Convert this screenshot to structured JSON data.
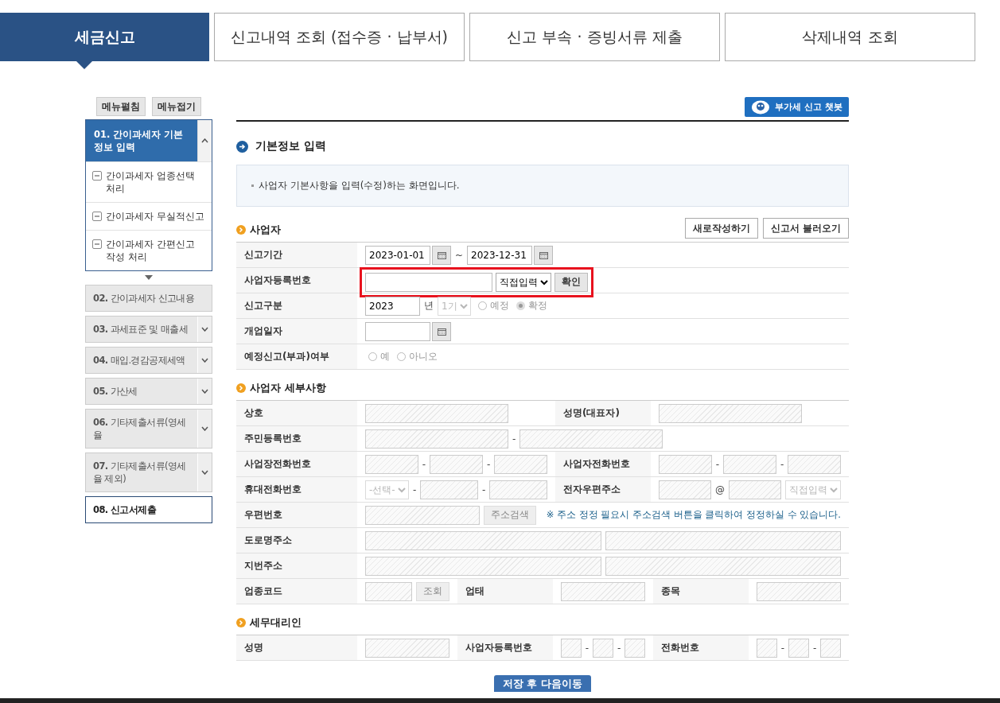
{
  "tabs": [
    {
      "label": "세금신고",
      "selected": true
    },
    {
      "label": "신고내역 조회 (접수증 · 납부서)",
      "selected": false
    },
    {
      "label": "신고 부속 · 증빙서류 제출",
      "selected": false
    },
    {
      "label": "삭제내역 조회",
      "selected": false
    }
  ],
  "sidebar": {
    "buttons": [
      "메뉴펼침",
      "메뉴접기"
    ],
    "steps": [
      {
        "number": "01.",
        "label": "간이과세자 기본정보 입력",
        "selected": true,
        "disabled": false,
        "expanded": true,
        "children": [
          "간이과세자 업종선택 처리",
          "간이과세자 무실적신고",
          "간이과세자 간편신고 작성 처리"
        ]
      },
      {
        "number": "02.",
        "label": "간이과세자 신고내용",
        "selected": false,
        "disabled": true
      },
      {
        "number": "03.",
        "label": "과세표준 및 매출세",
        "selected": false,
        "disabled": true,
        "expanded": false
      },
      {
        "number": "04.",
        "label": "매입.경감공제세액",
        "selected": false,
        "disabled": true,
        "expanded": false
      },
      {
        "number": "05.",
        "label": "가산세",
        "selected": false,
        "disabled": true,
        "expanded": false
      },
      {
        "number": "06.",
        "label": "기타제출서류(영세율",
        "selected": false,
        "disabled": true,
        "expanded": false
      },
      {
        "number": "07.",
        "label": "기타제출서류(영세율 제외)",
        "selected": false,
        "disabled": true,
        "expanded": false
      },
      {
        "number": "08.",
        "label": "신고서제출",
        "selected": false,
        "disabled": false
      }
    ]
  },
  "main": {
    "chatbot_button": "부가세 신고 챗봇",
    "title": "기본정보 입력",
    "notice": "사업자 기본사항을 입력(수정)하는 화면입니다.",
    "sections": [
      {
        "title": "사업자",
        "buttons": [
          "새로작성하기",
          "신고서 불러오기"
        ],
        "rows": [
          {
            "kind": "standard",
            "cells": [
              {
                "kind": "label",
                "text": "신고기간"
              },
              {
                "kind": "value",
                "controls": [
                  {
                    "kind": "date",
                    "value": "2023-01-01"
                  },
                  {
                    "kind": "text",
                    "text": "~"
                  },
                  {
                    "kind": "date",
                    "value": "2023-12-31"
                  }
                ]
              }
            ]
          },
          {
            "kind": "standard",
            "cells": [
              {
                "kind": "label",
                "text": "사업자등록번호"
              },
              {
                "kind": "value",
                "highlighted": true,
                "controls": [
                  {
                    "kind": "input",
                    "disabled": false
                  },
                  {
                    "kind": "select",
                    "value": "직접입력",
                    "disabled": false
                  },
                  {
                    "kind": "button",
                    "label": "확인",
                    "disabled": false
                  }
                ]
              }
            ]
          },
          {
            "kind": "standard",
            "cells": [
              {
                "kind": "label",
                "text": "신고구분"
              },
              {
                "kind": "value",
                "controls": [
                  {
                    "kind": "input",
                    "value": "2023",
                    "disabled": false
                  },
                  {
                    "kind": "text",
                    "text": "년"
                  },
                  {
                    "kind": "select",
                    "value": "1기",
                    "disabled": true
                  },
                  {
                    "kind": "radio",
                    "label": "예정",
                    "checked": false,
                    "disabled": true
                  },
                  {
                    "kind": "radio",
                    "label": "확정",
                    "checked": true,
                    "disabled": true
                  }
                ]
              }
            ]
          },
          {
            "kind": "standard",
            "cells": [
              {
                "kind": "label",
                "text": "개업일자"
              },
              {
                "kind": "value",
                "controls": [
                  {
                    "kind": "date"
                  }
                ]
              }
            ]
          },
          {
            "kind": "standard",
            "cells": [
              {
                "kind": "label",
                "text": "예정신고(부과)여부"
              },
              {
                "kind": "value",
                "controls": [
                  {
                    "kind": "radio",
                    "label": "예",
                    "checked": false,
                    "disabled": true
                  },
                  {
                    "kind": "radio",
                    "label": "아니오",
                    "checked": false,
                    "disabled": true
                  }
                ]
              }
            ]
          }
        ]
      },
      {
        "title": "사업자 세부사항",
        "rows": [
          {
            "kind": "standard",
            "cells": [
              {
                "kind": "label",
                "text": "상호"
              },
              {
                "kind": "value",
                "controls": [
                  {
                    "kind": "input",
                    "disabled": true
                  }
                ]
              },
              {
                "kind": "label",
                "text": "성명(대표자)"
              },
              {
                "kind": "value",
                "controls": [
                  {
                    "kind": "input",
                    "disabled": true
                  }
                ]
              }
            ]
          },
          {
            "kind": "standard",
            "cells": [
              {
                "kind": "label",
                "text": "주민등록번호"
              },
              {
                "kind": "value",
                "controls": [
                  {
                    "kind": "input",
                    "disabled": true
                  },
                  {
                    "kind": "text",
                    "text": "-"
                  },
                  {
                    "kind": "input",
                    "disabled": true
                  }
                ]
              }
            ]
          },
          {
            "kind": "standard",
            "cells": [
              {
                "kind": "label",
                "text": "사업장전화번호"
              },
              {
                "kind": "value",
                "controls": [
                  {
                    "kind": "input",
                    "disabled": true
                  },
                  {
                    "kind": "text",
                    "text": "-"
                  },
                  {
                    "kind": "input",
                    "disabled": true
                  },
                  {
                    "kind": "text",
                    "text": "-"
                  },
                  {
                    "kind": "input",
                    "disabled": true
                  }
                ]
              },
              {
                "kind": "label",
                "text": "사업자전화번호"
              },
              {
                "kind": "value",
                "controls": [
                  {
                    "kind": "input",
                    "disabled": true
                  },
                  {
                    "kind": "text",
                    "text": "-"
                  },
                  {
                    "kind": "input",
                    "disabled": true
                  },
                  {
                    "kind": "text",
                    "text": "-"
                  },
                  {
                    "kind": "input",
                    "disabled": true
                  }
                ]
              }
            ]
          },
          {
            "kind": "standard",
            "cells": [
              {
                "kind": "label",
                "text": "휴대전화번호"
              },
              {
                "kind": "value",
                "controls": [
                  {
                    "kind": "select",
                    "value": "-선택-",
                    "disabled": true
                  },
                  {
                    "kind": "text",
                    "text": "-"
                  },
                  {
                    "kind": "input",
                    "disabled": true
                  },
                  {
                    "kind": "text",
                    "text": "-"
                  },
                  {
                    "kind": "input",
                    "disabled": true
                  }
                ]
              },
              {
                "kind": "label",
                "text": "전자우편주소"
              },
              {
                "kind": "value",
                "controls": [
                  {
                    "kind": "input",
                    "disabled": true
                  },
                  {
                    "kind": "text",
                    "text": "@"
                  },
                  {
                    "kind": "input",
                    "disabled": true
                  },
                  {
                    "kind": "select",
                    "value": "직접입력",
                    "disabled": true
                  }
                ]
              }
            ]
          },
          {
            "kind": "standard",
            "cells": [
              {
                "kind": "label",
                "text": "우편번호"
              },
              {
                "kind": "value",
                "controls": [
                  {
                    "kind": "input",
                    "disabled": true
                  },
                  {
                    "kind": "button",
                    "label": "주소검색",
                    "disabled": true
                  },
                  {
                    "kind": "note",
                    "text": "※ 주소 정정 필요시 주소검색 버튼을 클릭하여 정정하실 수 있습니다."
                  }
                ]
              }
            ]
          },
          {
            "kind": "address",
            "cells": [
              {
                "kind": "label",
                "text": "도로명주소"
              },
              {
                "kind": "value",
                "controls": [
                  {
                    "kind": "input",
                    "disabled": true
                  },
                  {
                    "kind": "input",
                    "disabled": true
                  }
                ]
              }
            ]
          },
          {
            "kind": "address",
            "cells": [
              {
                "kind": "label",
                "text": "지번주소"
              },
              {
                "kind": "value",
                "controls": [
                  {
                    "kind": "input",
                    "disabled": true
                  },
                  {
                    "kind": "input",
                    "disabled": true
                  }
                ]
              }
            ]
          },
          {
            "kind": "standard",
            "cells": [
              {
                "kind": "label",
                "text": "업종코드"
              },
              {
                "kind": "value",
                "controls": [
                  {
                    "kind": "input",
                    "disabled": true
                  },
                  {
                    "kind": "button",
                    "label": "조회",
                    "disabled": true
                  }
                ]
              },
              {
                "kind": "label",
                "text": "업태"
              },
              {
                "kind": "value",
                "controls": [
                  {
                    "kind": "input",
                    "disabled": true
                  }
                ]
              },
              {
                "kind": "label",
                "text": "종목"
              },
              {
                "kind": "value",
                "controls": [
                  {
                    "kind": "input",
                    "disabled": true
                  }
                ]
              }
            ]
          }
        ]
      },
      {
        "title": "세무대리인",
        "rows": [
          {
            "kind": "standard",
            "cells": [
              {
                "kind": "label",
                "text": "성명"
              },
              {
                "kind": "value",
                "controls": [
                  {
                    "kind": "input",
                    "disabled": true
                  }
                ]
              },
              {
                "kind": "label",
                "text": "사업자등록번호"
              },
              {
                "kind": "value",
                "controls": [
                  {
                    "kind": "input",
                    "disabled": true
                  },
                  {
                    "kind": "text",
                    "text": "-"
                  },
                  {
                    "kind": "input",
                    "disabled": true
                  },
                  {
                    "kind": "text",
                    "text": "-"
                  },
                  {
                    "kind": "input",
                    "disabled": true
                  }
                ]
              },
              {
                "kind": "label",
                "text": "전화번호"
              },
              {
                "kind": "value",
                "controls": [
                  {
                    "kind": "input",
                    "disabled": true
                  },
                  {
                    "kind": "text",
                    "text": "-"
                  },
                  {
                    "kind": "input",
                    "disabled": true
                  },
                  {
                    "kind": "text",
                    "text": "-"
                  },
                  {
                    "kind": "input",
                    "disabled": true
                  }
                ]
              }
            ]
          }
        ]
      }
    ],
    "save_button": "저장 후 다음이동"
  }
}
